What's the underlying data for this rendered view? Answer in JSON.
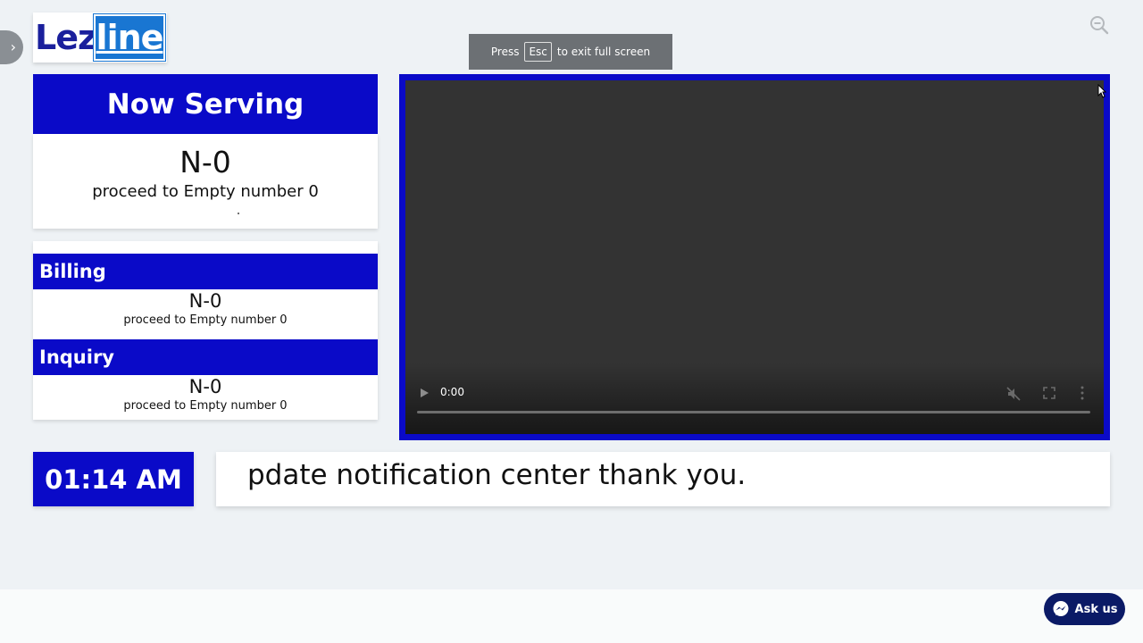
{
  "logo": {
    "part1": "Lez",
    "part2": "line"
  },
  "fullscreen_notice": {
    "prefix": "Press",
    "key": "Esc",
    "suffix": "to exit full screen"
  },
  "now_serving": {
    "title": "Now Serving",
    "number": "N-0",
    "message": "proceed to Empty number 0"
  },
  "queues": [
    {
      "name": "Billing",
      "number": "N-0",
      "message": "proceed to Empty number 0"
    },
    {
      "name": "Inquiry",
      "number": "N-0",
      "message": "proceed to Empty number 0"
    }
  ],
  "video": {
    "time": "0:00",
    "progress": 0,
    "muted": true
  },
  "clock": {
    "time": "01:14 AM"
  },
  "ticker": {
    "text": "pdate notification center thank you."
  },
  "chat_button": {
    "label": "Ask us"
  },
  "colors": {
    "primary": "#0a0ac8",
    "logo_text": "#1a1f9c",
    "logo_box": "#1976d2",
    "chat": "#0b1a66",
    "background": "#eef2f5"
  },
  "icons": {
    "side_toggle": "chevron-right-icon",
    "zoom": "zoom-out-icon",
    "play": "play-icon",
    "mute": "muted-speaker-icon",
    "fullscreen": "fullscreen-icon",
    "more": "more-vertical-icon",
    "chat": "messenger-icon"
  }
}
